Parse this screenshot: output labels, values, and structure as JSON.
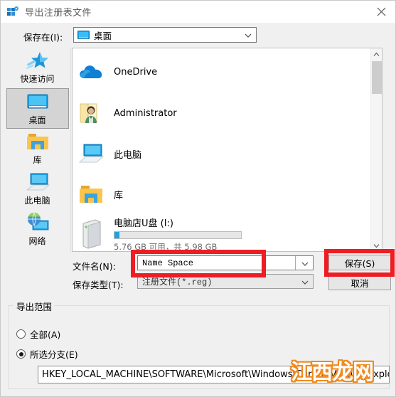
{
  "window": {
    "title": "导出注册表文件",
    "icon": "registry-editor-icon",
    "close_label": "✕"
  },
  "toolbar": {
    "save_in_label": "保存在(I):",
    "save_in_value": "桌面",
    "save_in_icon": "monitor-icon",
    "chevron": "⌄",
    "buttons": [
      {
        "name": "back-button",
        "icon": "back-arrow-icon"
      },
      {
        "name": "up-one-level-button",
        "icon": "up-folder-icon"
      },
      {
        "name": "new-folder-button",
        "icon": "new-folder-icon"
      },
      {
        "name": "view-menu-button",
        "icon": "view-icon"
      }
    ]
  },
  "places": [
    {
      "label": "快速访问",
      "icon": "quick-access-star-icon",
      "selected": false
    },
    {
      "label": "桌面",
      "icon": "desktop-monitor-icon",
      "selected": true
    },
    {
      "label": "库",
      "icon": "library-folder-icon",
      "selected": false
    },
    {
      "label": "此电脑",
      "icon": "this-pc-icon",
      "selected": false
    },
    {
      "label": "网络",
      "icon": "network-globe-icon",
      "selected": false
    }
  ],
  "file_list": {
    "items": [
      {
        "name": "OneDrive",
        "icon": "onedrive-cloud-icon",
        "type": "folder"
      },
      {
        "name": "Administrator",
        "icon": "user-folder-icon",
        "type": "folder"
      },
      {
        "name": "此电脑",
        "icon": "this-pc-icon",
        "type": "computer"
      },
      {
        "name": "库",
        "icon": "library-folder-icon",
        "type": "folder"
      }
    ],
    "drive": {
      "name": "电脑店U盘 (I:)",
      "icon": "removable-drive-icon",
      "capacity_text": "5.76 GB 可用，共 5.98 GB",
      "used_percent": 4,
      "bar_color": "#26a0da"
    },
    "scrollbar": {
      "up_arrow": "⌃",
      "down_arrow": "⌄"
    }
  },
  "form": {
    "filename_label": "文件名(N):",
    "filename_value": "Name Space",
    "filename_placeholder": "",
    "filetype_label": "保存类型(T):",
    "filetype_value": "注册文件(*.reg)",
    "chevron": "⌄",
    "save_button": "保存(S)",
    "cancel_button": "取消"
  },
  "export_range": {
    "group_title": "导出范围",
    "options": [
      {
        "label": "全部(A)",
        "selected": false
      },
      {
        "label": "所选分支(E)",
        "selected": true
      }
    ],
    "branch_path": "HKEY_LOCAL_MACHINE\\SOFTWARE\\Microsoft\\Windows\\CurrentVersion\\Explorer\\"
  },
  "annotations": {
    "highlight_color": "#ee1c23",
    "boxes": [
      {
        "name": "filename-highlight"
      },
      {
        "name": "save-button-highlight"
      }
    ]
  },
  "watermark": {
    "text": "江西龙网",
    "fill": "#ffffff",
    "stroke": "#f08a1e"
  }
}
